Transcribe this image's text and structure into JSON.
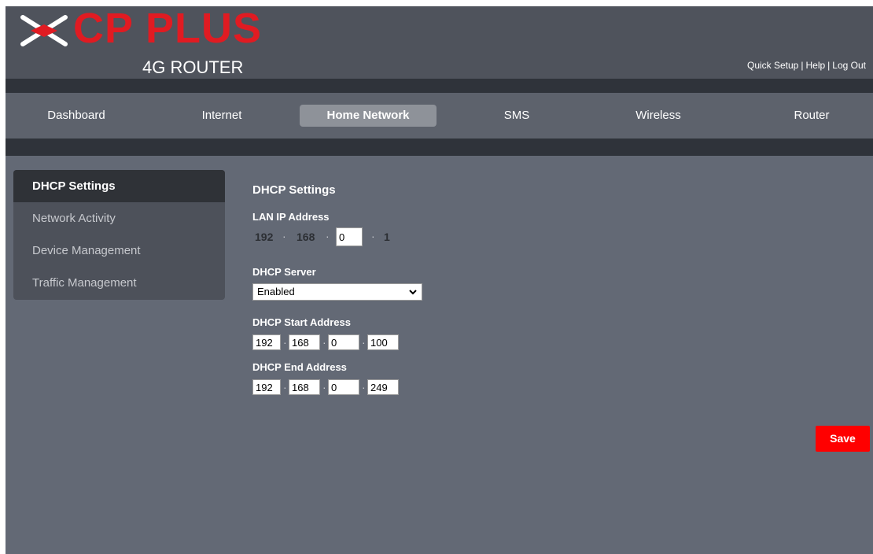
{
  "header": {
    "brand": "CP PLUS",
    "subtitle": "4G ROUTER",
    "links": [
      "Quick Setup",
      "Help",
      "Log Out"
    ],
    "separator": "|"
  },
  "nav": {
    "items": [
      {
        "label": "Dashboard",
        "active": false
      },
      {
        "label": "Internet",
        "active": false
      },
      {
        "label": "Home Network",
        "active": true
      },
      {
        "label": "SMS",
        "active": false
      },
      {
        "label": "Wireless",
        "active": false
      },
      {
        "label": "Router",
        "active": false
      }
    ]
  },
  "sidebar": {
    "items": [
      {
        "label": "DHCP Settings",
        "active": true
      },
      {
        "label": "Network Activity",
        "active": false
      },
      {
        "label": "Device Management",
        "active": false
      },
      {
        "label": "Traffic Management",
        "active": false
      }
    ]
  },
  "main": {
    "title": "DHCP Settings",
    "lan_ip": {
      "label": "LAN IP Address",
      "octets": [
        "192",
        "168",
        "0",
        "1"
      ]
    },
    "dhcp_server": {
      "label": "DHCP Server",
      "value": "Enabled"
    },
    "dhcp_start": {
      "label": "DHCP Start Address",
      "octets": [
        "192",
        "168",
        "0",
        "100"
      ]
    },
    "dhcp_end": {
      "label": "DHCP End Address",
      "octets": [
        "192",
        "168",
        "0",
        "249"
      ]
    },
    "save_label": "Save"
  },
  "colors": {
    "brand_red": "#e01b22",
    "save_red": "#ff0000",
    "page_bg": "#636975",
    "header_bg": "#4f535c",
    "dark_band": "#2f333a",
    "active_tab": "#8e9299"
  },
  "icons": {
    "logo": "cp-plus-logo-icon",
    "select_chevron": "chevron-down-icon"
  }
}
